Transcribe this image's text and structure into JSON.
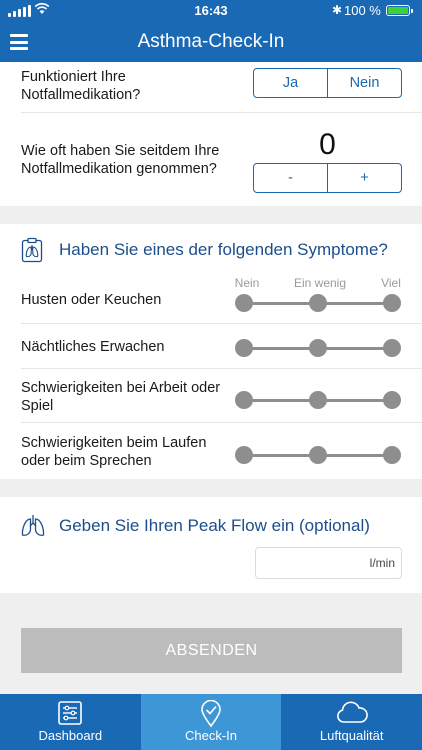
{
  "status_bar": {
    "time": "16:43",
    "battery": "100 %"
  },
  "nav": {
    "title": "Asthma-Check-In"
  },
  "medication": {
    "question": "Funktioniert Ihre Notfallmedikation?",
    "yes_label": "Ja",
    "no_label": "Nein"
  },
  "usage": {
    "question": "Wie oft haben Sie seitdem Ihre Notfallmedikation genommen?",
    "count": "0",
    "minus_label": "-",
    "plus_label": "+"
  },
  "symptoms": {
    "title": "Haben Sie eines der folgenden Symptome?",
    "scale": [
      "Nein",
      "Ein wenig",
      "Viel"
    ],
    "items": [
      {
        "label": "Husten oder Keuchen"
      },
      {
        "label": "Nächtliches Erwachen"
      },
      {
        "label": "Schwierigkeiten bei Arbeit oder Spiel"
      },
      {
        "label": "Schwierigkeiten beim Laufen oder beim Sprechen"
      }
    ]
  },
  "peak_flow": {
    "title": "Geben Sie Ihren Peak Flow ein (optional)",
    "unit": "l/min",
    "value": ""
  },
  "submit_label": "ABSENDEN",
  "tabs": [
    {
      "label": "Dashboard",
      "icon": "dashboard-icon"
    },
    {
      "label": "Check-In",
      "icon": "check-in-icon",
      "active": true
    },
    {
      "label": "Luftqualität",
      "icon": "cloud-icon"
    }
  ],
  "colors": {
    "primary": "#1a69b5",
    "active_tab": "#3d97d6",
    "section_title": "#1d4e8c",
    "disabled_button": "#bcbcbc"
  }
}
